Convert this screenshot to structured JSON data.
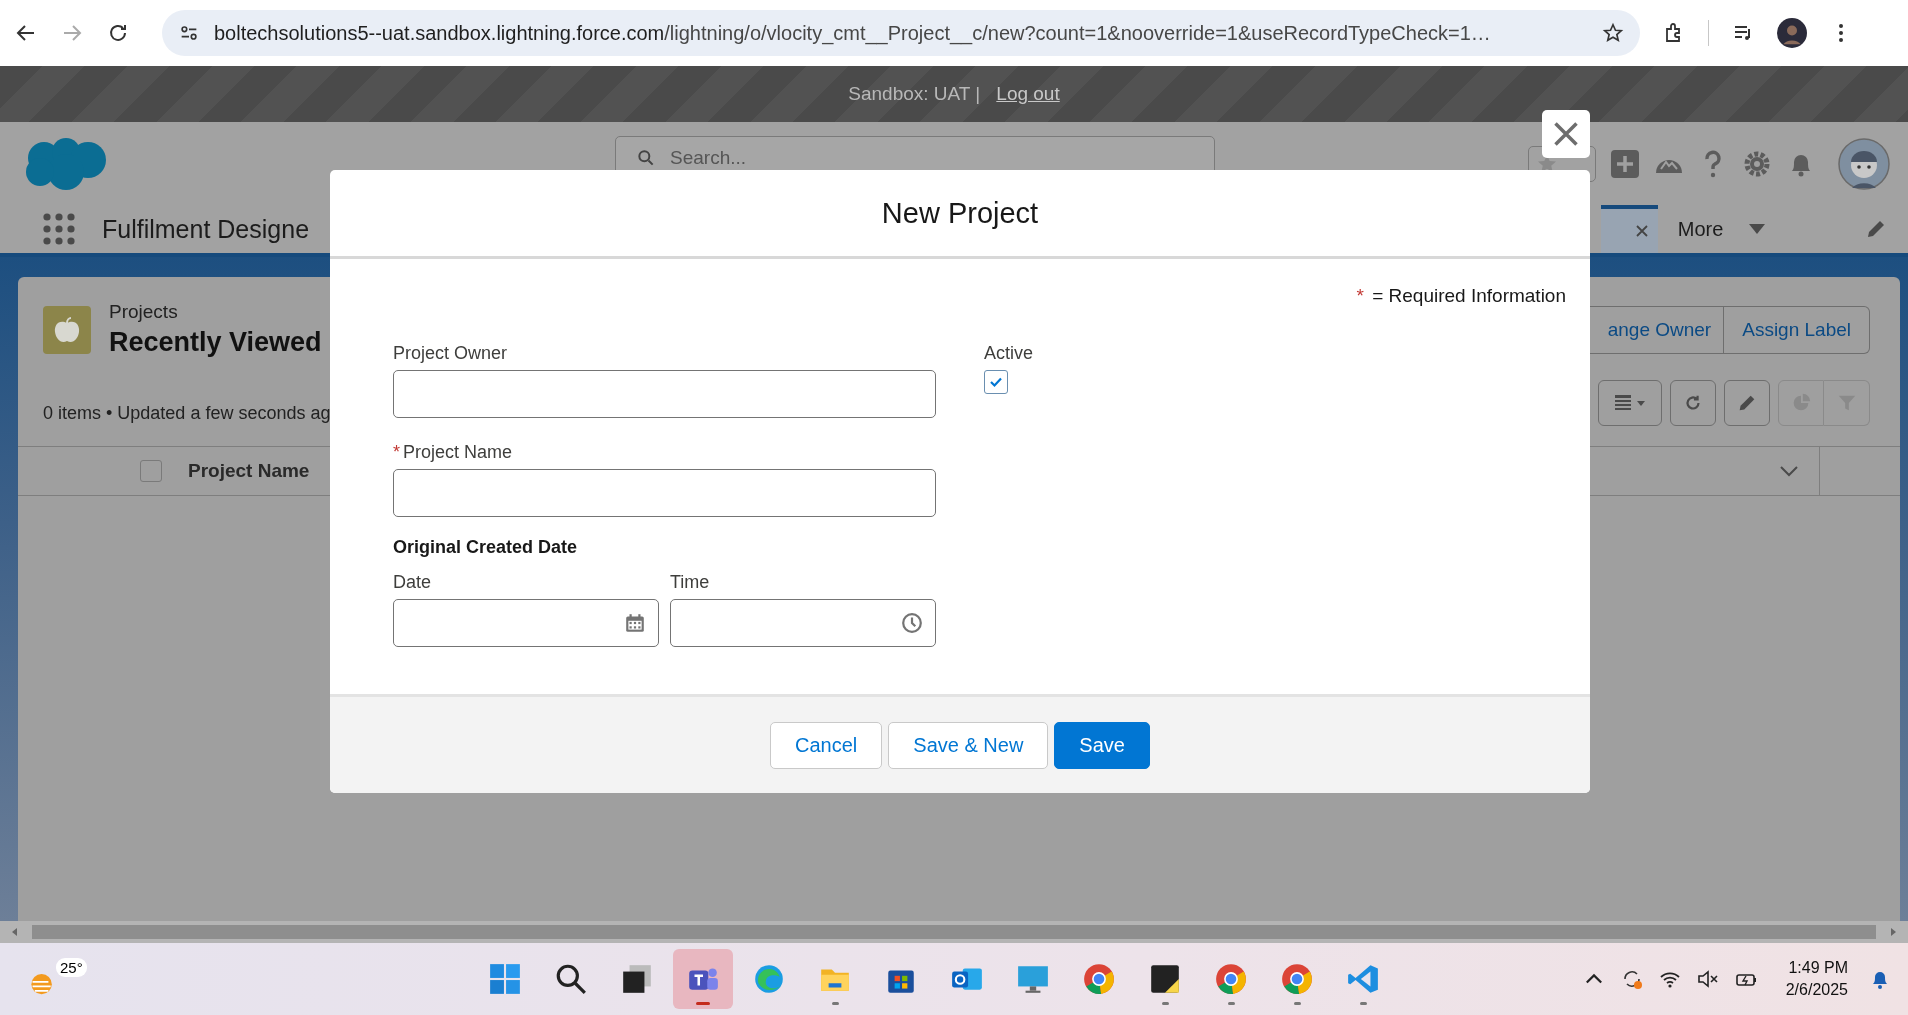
{
  "browser": {
    "url_host": "boltechsolutions5--uat.sandbox.lightning.force.com",
    "url_path": "/lightning/o/vlocity_cmt__Project__c/new?count=1&nooverride=1&useRecordTypeCheck=1…"
  },
  "sandbox_bar": {
    "label": "Sandbox: UAT |",
    "logout": "Log out"
  },
  "header": {
    "search_placeholder": "Search..."
  },
  "nav": {
    "app_name": "Fulfilment Designe",
    "more": "More"
  },
  "list_view": {
    "object": "Projects",
    "title": "Recently Viewed",
    "status": "0 items • Updated a few seconds ag",
    "actions": [
      "ange Owner",
      "Assign Label"
    ],
    "column": "Project Name",
    "select_all_checked": false
  },
  "modal": {
    "title": "New Project",
    "required_note": {
      "mark": "*",
      "text": "= Required Information"
    },
    "fields": [
      {
        "label": "Project Owner"
      },
      {
        "label": "Project Name",
        "required_mark": "*"
      }
    ],
    "active": {
      "label": "Active",
      "checked": true
    },
    "date_group": {
      "title": "Original Created Date",
      "date_label": "Date",
      "time_label": "Time"
    },
    "buttons": [
      {
        "label": "Cancel",
        "kind": "neutral"
      },
      {
        "label": "Save & New",
        "kind": "neutral"
      },
      {
        "label": "Save",
        "kind": "brand"
      }
    ]
  },
  "taskbar": {
    "weather": "25°",
    "time": "1:49 PM",
    "date": "2/6/2025",
    "apps": [
      {
        "kind": "start",
        "selected": false,
        "running": false
      },
      {
        "kind": "search",
        "selected": false,
        "running": false
      },
      {
        "kind": "taskview",
        "selected": false,
        "running": false
      },
      {
        "kind": "teams",
        "selected": true,
        "running": true
      },
      {
        "kind": "edge",
        "selected": false,
        "running": false
      },
      {
        "kind": "files",
        "selected": false,
        "running": true
      },
      {
        "kind": "store",
        "selected": false,
        "running": false
      },
      {
        "kind": "outlook",
        "selected": false,
        "running": false
      },
      {
        "kind": "monitor",
        "selected": false,
        "running": false
      },
      {
        "kind": "chrome",
        "selected": false,
        "running": false
      },
      {
        "kind": "sticky",
        "selected": false,
        "running": true
      },
      {
        "kind": "chrome",
        "selected": false,
        "running": true
      },
      {
        "kind": "chrome",
        "selected": false,
        "running": true
      },
      {
        "kind": "vscode",
        "selected": false,
        "running": true
      }
    ]
  }
}
